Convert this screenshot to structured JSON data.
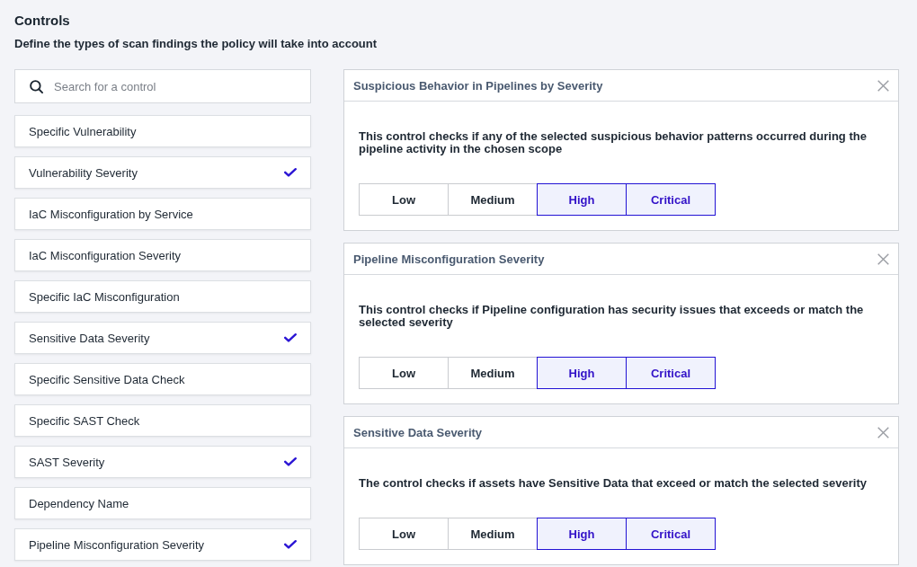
{
  "header": {
    "title": "Controls",
    "subtitle": "Define the types of scan findings the policy will take into account"
  },
  "search": {
    "placeholder": "Search for a control"
  },
  "controls": [
    {
      "label": "Specific Vulnerability",
      "checked": false
    },
    {
      "label": "Vulnerability Severity",
      "checked": true
    },
    {
      "label": "IaC Misconfiguration by Service",
      "checked": false
    },
    {
      "label": "IaC Misconfiguration Severity",
      "checked": false
    },
    {
      "label": "Specific IaC Misconfiguration",
      "checked": false
    },
    {
      "label": "Sensitive Data Severity",
      "checked": true
    },
    {
      "label": "Specific Sensitive Data Check",
      "checked": false
    },
    {
      "label": "Specific SAST Check",
      "checked": false
    },
    {
      "label": "SAST Severity",
      "checked": true
    },
    {
      "label": "Dependency Name",
      "checked": false
    },
    {
      "label": "Pipeline Misconfiguration Severity",
      "checked": true
    }
  ],
  "panels": [
    {
      "title": "Suspicious Behavior in Pipelines by Severity",
      "description": "This control checks if any of the selected suspicious behavior patterns occurred during the pipeline activity in the chosen scope",
      "severities": [
        {
          "label": "Low",
          "selected": false
        },
        {
          "label": "Medium",
          "selected": false
        },
        {
          "label": "High",
          "selected": true
        },
        {
          "label": "Critical",
          "selected": true
        }
      ]
    },
    {
      "title": "Pipeline Misconfiguration Severity",
      "description": "This control checks if Pipeline configuration has security issues that exceeds or match the selected severity",
      "severities": [
        {
          "label": "Low",
          "selected": false
        },
        {
          "label": "Medium",
          "selected": false
        },
        {
          "label": "High",
          "selected": true
        },
        {
          "label": "Critical",
          "selected": true
        }
      ]
    },
    {
      "title": "Sensitive Data Severity",
      "description": "The control checks if assets have Sensitive Data that exceed or match the selected severity",
      "severities": [
        {
          "label": "Low",
          "selected": false
        },
        {
          "label": "Medium",
          "selected": false
        },
        {
          "label": "High",
          "selected": true
        },
        {
          "label": "Critical",
          "selected": true
        }
      ]
    }
  ]
}
